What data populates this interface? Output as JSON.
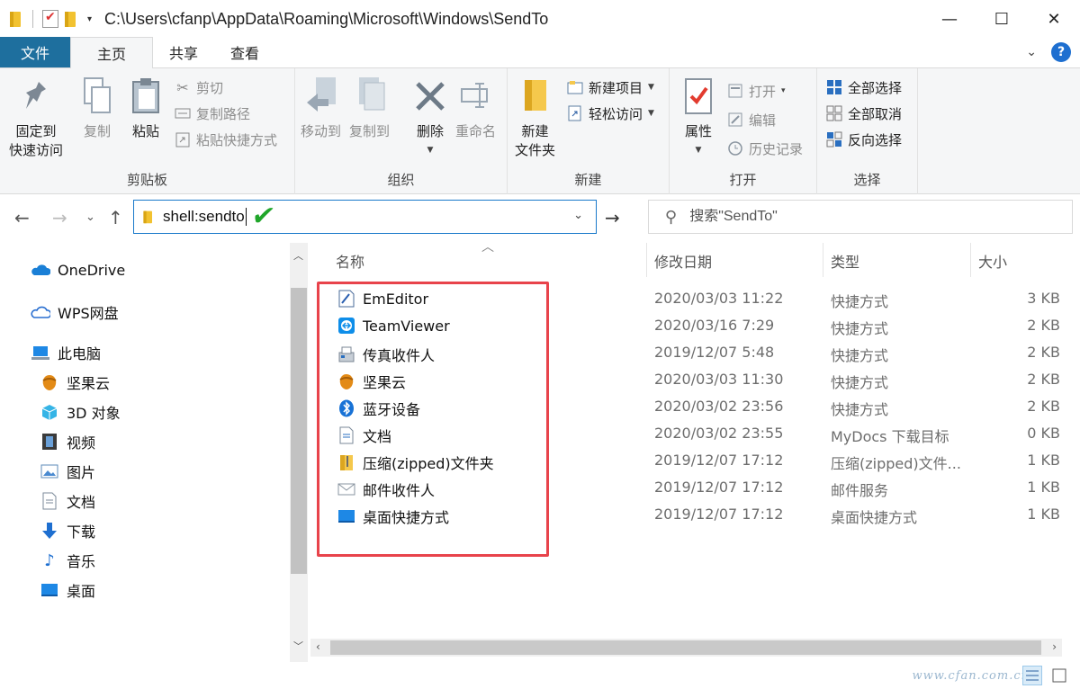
{
  "window": {
    "title_path": "C:\\Users\\cfanp\\AppData\\Roaming\\Microsoft\\Windows\\SendTo",
    "minimize": "—",
    "maximize": "☐",
    "close": "✕"
  },
  "tabs": [
    {
      "label": "文件"
    },
    {
      "label": "主页"
    },
    {
      "label": "共享"
    },
    {
      "label": "查看"
    }
  ],
  "ribbon": {
    "clipboard": {
      "label": "剪贴板",
      "pin_line1": "固定到",
      "pin_line2": "快速访问",
      "copy": "复制",
      "paste": "粘贴",
      "cut": "剪切",
      "copy_path": "复制路径",
      "paste_shortcut": "粘贴快捷方式"
    },
    "organize": {
      "label": "组织",
      "move_to": "移动到",
      "copy_to": "复制到",
      "delete": "删除",
      "rename": "重命名"
    },
    "new": {
      "label": "新建",
      "new_folder_line1": "新建",
      "new_folder_line2": "文件夹",
      "new_item": "新建项目",
      "easy_access": "轻松访问"
    },
    "open": {
      "label": "打开",
      "properties": "属性",
      "open": "打开",
      "edit": "编辑",
      "history": "历史记录"
    },
    "select": {
      "label": "选择",
      "select_all": "全部选择",
      "select_none": "全部取消",
      "invert": "反向选择"
    }
  },
  "address": {
    "value": "shell:sendto"
  },
  "search": {
    "placeholder": "搜索\"SendTo\""
  },
  "nav_pane": [
    {
      "label": "OneDrive",
      "icon": "cloud-icon"
    },
    {
      "label": "WPS网盘",
      "icon": "cloud-outline-icon"
    },
    {
      "label": "此电脑",
      "icon": "computer-icon"
    },
    {
      "label": "坚果云",
      "icon": "nut-icon"
    },
    {
      "label": "3D 对象",
      "icon": "cube-icon"
    },
    {
      "label": "视频",
      "icon": "film-icon"
    },
    {
      "label": "图片",
      "icon": "picture-icon"
    },
    {
      "label": "文档",
      "icon": "document-icon"
    },
    {
      "label": "下载",
      "icon": "download-icon"
    },
    {
      "label": "音乐",
      "icon": "music-icon"
    },
    {
      "label": "桌面",
      "icon": "desktop-icon"
    }
  ],
  "columns": {
    "name": "名称",
    "date": "修改日期",
    "type": "类型",
    "size": "大小"
  },
  "files": [
    {
      "name": "EmEditor",
      "date": "2020/03/03 11:22",
      "type": "快捷方式",
      "size": "3 KB",
      "icon": "emeditor-icon"
    },
    {
      "name": "TeamViewer",
      "date": "2020/03/16 7:29",
      "type": "快捷方式",
      "size": "2 KB",
      "icon": "teamviewer-icon"
    },
    {
      "name": "传真收件人",
      "date": "2019/12/07 5:48",
      "type": "快捷方式",
      "size": "2 KB",
      "icon": "fax-icon"
    },
    {
      "name": "坚果云",
      "date": "2020/03/03 11:30",
      "type": "快捷方式",
      "size": "2 KB",
      "icon": "nut-icon"
    },
    {
      "name": "蓝牙设备",
      "date": "2020/03/02 23:56",
      "type": "快捷方式",
      "size": "2 KB",
      "icon": "bluetooth-icon"
    },
    {
      "name": "文档",
      "date": "2020/03/02 23:55",
      "type": "MyDocs 下载目标",
      "size": "0 KB",
      "icon": "document-icon"
    },
    {
      "name": "压缩(zipped)文件夹",
      "date": "2019/12/07 17:12",
      "type": "压缩(zipped)文件...",
      "size": "1 KB",
      "icon": "zip-folder-icon"
    },
    {
      "name": "邮件收件人",
      "date": "2019/12/07 17:12",
      "type": "邮件服务",
      "size": "1 KB",
      "icon": "mail-icon"
    },
    {
      "name": "桌面快捷方式",
      "date": "2019/12/07 17:12",
      "type": "桌面快捷方式",
      "size": "1 KB",
      "icon": "desktop-icon"
    }
  ],
  "watermark": "www.cfan.com.cn",
  "colors": {
    "file_tab": "#1e6f9e",
    "address_border": "#1979ca",
    "highlight": "#e8434b",
    "check": "#20a62a"
  }
}
